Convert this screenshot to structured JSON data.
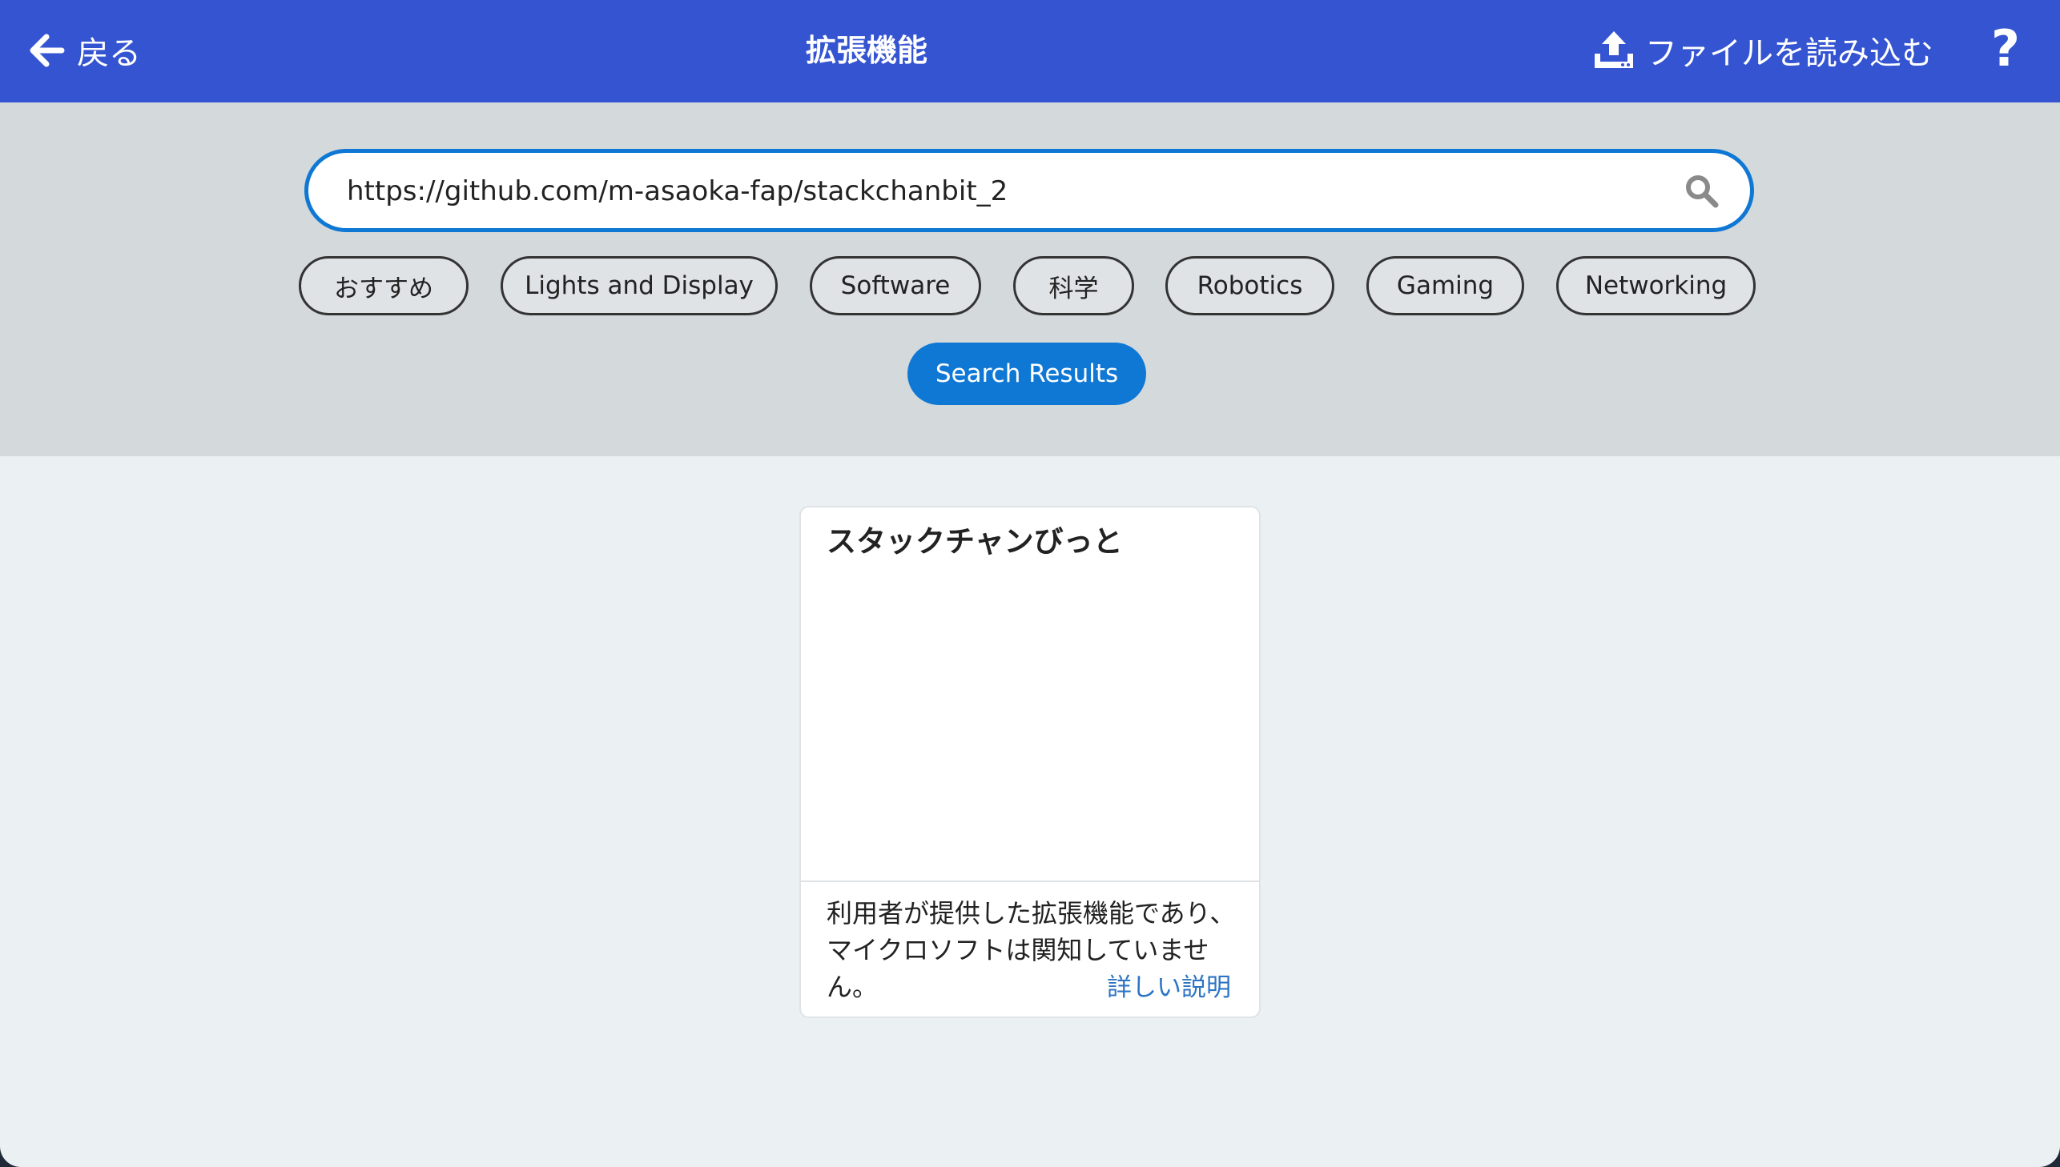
{
  "header": {
    "back_label": "戻る",
    "title": "拡張機能",
    "import_label": "ファイルを読み込む",
    "help_label": "?"
  },
  "search": {
    "value": "https://github.com/m-asaoka-fap/stackchanbit_2",
    "icon": "search-icon"
  },
  "categories": [
    "おすすめ",
    "Lights and Display",
    "Software",
    "科学",
    "Robotics",
    "Gaming",
    "Networking"
  ],
  "results_button": "Search Results",
  "card": {
    "title": "スタックチャンびっと",
    "description": "利用者が提供した拡張機能であり、マイクロソフトは関知していません。",
    "link": "詳しい説明"
  },
  "colors": {
    "header": "#3454d1",
    "accent": "#0f78d4",
    "search_region": "#d4d9dc",
    "content_bg": "#ebf0f3"
  }
}
